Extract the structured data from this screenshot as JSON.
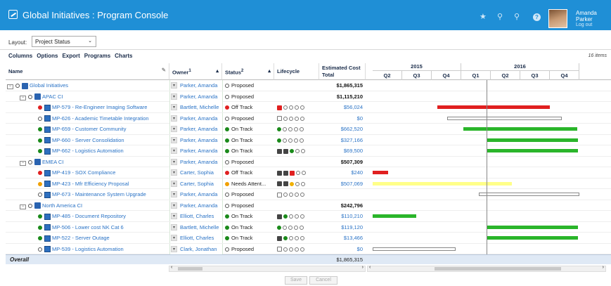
{
  "app": {
    "title": "Global Initiatives : Program Console",
    "user_first": "Amanda",
    "user_last": "Parker",
    "logout": "Log out"
  },
  "layout": {
    "label": "Layout:",
    "value": "Project Status"
  },
  "toolbar": [
    "Columns",
    "Options",
    "Export",
    "Programs",
    "Charts"
  ],
  "items_count": "16 items",
  "columns": {
    "name": "Name",
    "owner": "Owner",
    "owner_sort": "1",
    "status": "Status",
    "status_sort": "2",
    "lifecycle": "Lifecycle",
    "cost_l1": "Estimated Cost",
    "cost_l2": "Total"
  },
  "gantt": {
    "years": [
      "2015",
      "2016"
    ],
    "quarters": [
      "Q2",
      "Q3",
      "Q4",
      "Q1",
      "Q2",
      "Q3",
      "Q4"
    ]
  },
  "rows": [
    {
      "level": 0,
      "type": "portfolio",
      "name": "Global Initiatives",
      "owner": "Parker, Amanda",
      "status": "Proposed",
      "status_kind": "proposed",
      "lifecycle": "",
      "cost": "$1,865,315",
      "cost_bold": true,
      "bar": null
    },
    {
      "level": 1,
      "type": "program",
      "name": "APAC CI",
      "owner": "Parker, Amanda",
      "status": "Proposed",
      "status_kind": "proposed",
      "lifecycle": "",
      "cost": "$1,115,210",
      "cost_bold": true,
      "bar": null
    },
    {
      "level": 2,
      "type": "project",
      "name": "MP-579 - Re-Engineer Imaging Software",
      "owner": "Bartlett, Michelle",
      "status": "Off Track",
      "status_kind": "offtrack",
      "lifecycle": "r0000",
      "cost": "$56,024",
      "cost_bold": false,
      "bar": {
        "start": 2015.8,
        "end": 2016.75,
        "color": "#e02020"
      }
    },
    {
      "level": 2,
      "type": "project",
      "name": "MP-626 - Academic Timetable Integration",
      "owner": "Parker, Amanda",
      "status": "Proposed",
      "status_kind": "proposed",
      "lifecycle": "o0000",
      "cost": "$0",
      "cost_bold": false,
      "bar": {
        "start": 2015.88,
        "end": 2016.85,
        "color": "#ffffff"
      }
    },
    {
      "level": 2,
      "type": "project",
      "name": "MP-659 - Customer Community",
      "owner": "Parker, Amanda",
      "status": "On Track",
      "status_kind": "ontrack",
      "lifecycle": "g0000",
      "cost": "$662,520",
      "cost_bold": false,
      "bar": {
        "start": 2016.02,
        "end": 2016.98,
        "color": "#2ab52a"
      }
    },
    {
      "level": 2,
      "type": "project",
      "name": "MP-660 - Server Consolidation",
      "owner": "Parker, Amanda",
      "status": "On Track",
      "status_kind": "ontrack",
      "lifecycle": "g0000",
      "cost": "$327,166",
      "cost_bold": false,
      "bar": {
        "start": 2016.22,
        "end": 2016.99,
        "color": "#2ab52a"
      }
    },
    {
      "level": 2,
      "type": "project",
      "name": "MP-662 - Logistics Automation",
      "owner": "Parker, Amanda",
      "status": "On Track",
      "status_kind": "ontrack",
      "lifecycle": "ddg00",
      "cost": "$69,500",
      "cost_bold": false,
      "bar": {
        "start": 2016.22,
        "end": 2016.99,
        "color": "#2ab52a"
      }
    },
    {
      "level": 1,
      "type": "program",
      "name": "EMEA CI",
      "owner": "Parker, Amanda",
      "status": "Proposed",
      "status_kind": "proposed",
      "lifecycle": "",
      "cost": "$507,309",
      "cost_bold": true,
      "bar": null
    },
    {
      "level": 2,
      "type": "project",
      "name": "MP-419 - SOX Compliance",
      "owner": "Carter, Sophia",
      "status": "Off Track",
      "status_kind": "offtrack",
      "lifecycle": "ddr00",
      "cost": "$240",
      "cost_bold": false,
      "bar": {
        "start": 2015.25,
        "end": 2015.38,
        "color": "#e02020"
      }
    },
    {
      "level": 2,
      "type": "project",
      "name": "MP-423 - Mfr Efficiency Proposal",
      "owner": "Carter, Sophia",
      "status": "Needs Attent...",
      "status_kind": "attention",
      "lifecycle": "ddy00",
      "cost": "$507,069",
      "cost_bold": false,
      "bar": {
        "start": 2015.25,
        "end": 2016.43,
        "color": "#ffff88"
      }
    },
    {
      "level": 2,
      "type": "project",
      "name": "MP-673 - Maintenance System Upgrade",
      "owner": "Parker, Amanda",
      "status": "Proposed",
      "status_kind": "proposed",
      "lifecycle": "o0000",
      "cost": "",
      "cost_bold": false,
      "bar": {
        "start": 2016.15,
        "end": 2017.0,
        "color": "#ffffff"
      }
    },
    {
      "level": 1,
      "type": "program",
      "name": "North America CI",
      "owner": "Parker, Amanda",
      "status": "Proposed",
      "status_kind": "proposed",
      "lifecycle": "",
      "cost": "$242,796",
      "cost_bold": true,
      "bar": null
    },
    {
      "level": 2,
      "type": "project",
      "name": "MP-485 - Document Repository",
      "owner": "Elliott, Charles",
      "status": "On Track",
      "status_kind": "ontrack",
      "lifecycle": "dg000",
      "cost": "$110,210",
      "cost_bold": false,
      "bar": {
        "start": 2015.25,
        "end": 2015.62,
        "color": "#2ab52a"
      }
    },
    {
      "level": 2,
      "type": "project",
      "name": "MP-506 - Lower cost NK Cat 6",
      "owner": "Bartlett, Michelle",
      "status": "On Track",
      "status_kind": "ontrack",
      "lifecycle": "g0000",
      "cost": "$119,120",
      "cost_bold": false,
      "bar": {
        "start": 2016.22,
        "end": 2016.99,
        "color": "#2ab52a"
      }
    },
    {
      "level": 2,
      "type": "project",
      "name": "MP-522 - Server Outage",
      "owner": "Elliott, Charles",
      "status": "On Track",
      "status_kind": "ontrack",
      "lifecycle": "dg000",
      "cost": "$13,466",
      "cost_bold": false,
      "bar": {
        "start": 2016.22,
        "end": 2016.99,
        "color": "#2ab52a"
      }
    },
    {
      "level": 2,
      "type": "project",
      "name": "MP-539 - Logistics Automation",
      "owner": "Clark, Jonathan",
      "status": "Proposed",
      "status_kind": "proposed",
      "lifecycle": "o0000",
      "cost": "$0",
      "cost_bold": false,
      "bar": {
        "start": 2015.25,
        "end": 2015.95,
        "color": "#ffffff"
      }
    }
  ],
  "overall": {
    "label": "Overall",
    "cost": "$1,865,315"
  },
  "buttons": {
    "save": "Save",
    "cancel": "Cancel"
  },
  "colors": {
    "header": "#1f8fd6",
    "green": "#2ab52a",
    "red": "#e02020",
    "yellow": "#ffff88",
    "link": "#2a73c6"
  }
}
